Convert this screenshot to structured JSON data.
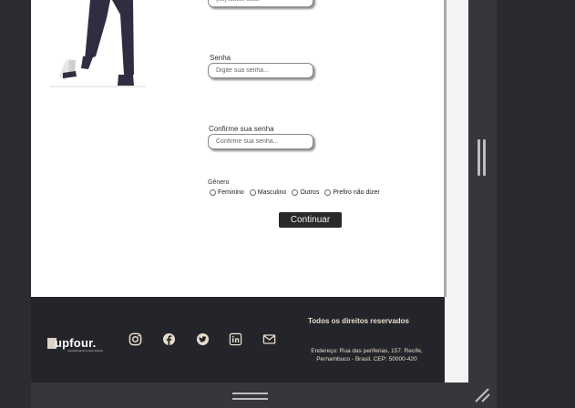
{
  "form": {
    "phone": {
      "placeholder": "(xx) xxxxx-xxxx"
    },
    "password": {
      "label": "Senha",
      "placeholder": "Digite sua senha..."
    },
    "confirm_password": {
      "label": "Confirme sua senha",
      "placeholder": "Confirme sua senha..."
    },
    "gender": {
      "label": "Gênero",
      "options": [
        "Feminino",
        "Masculino",
        "Outros",
        "Prefiro não dizer"
      ]
    },
    "submit_label": "Continuar"
  },
  "footer": {
    "brand": "upfour.",
    "tagline": "Impulsionando a sua carreira",
    "social_icons": [
      "instagram-icon",
      "facebook-icon",
      "twitter-icon",
      "linkedin-icon",
      "mail-icon"
    ],
    "rights": "Todos os direitos reservados",
    "address": "Endereço: Rua das periferias, 157. Recife, Pernambuco - Brasil. CEP: 50000-420"
  },
  "colors": {
    "footer_bg": "#24252a",
    "footer_text": "#e6dccb",
    "button_bg": "#2a2a2a",
    "illustration_pants": "#2f2e41"
  }
}
